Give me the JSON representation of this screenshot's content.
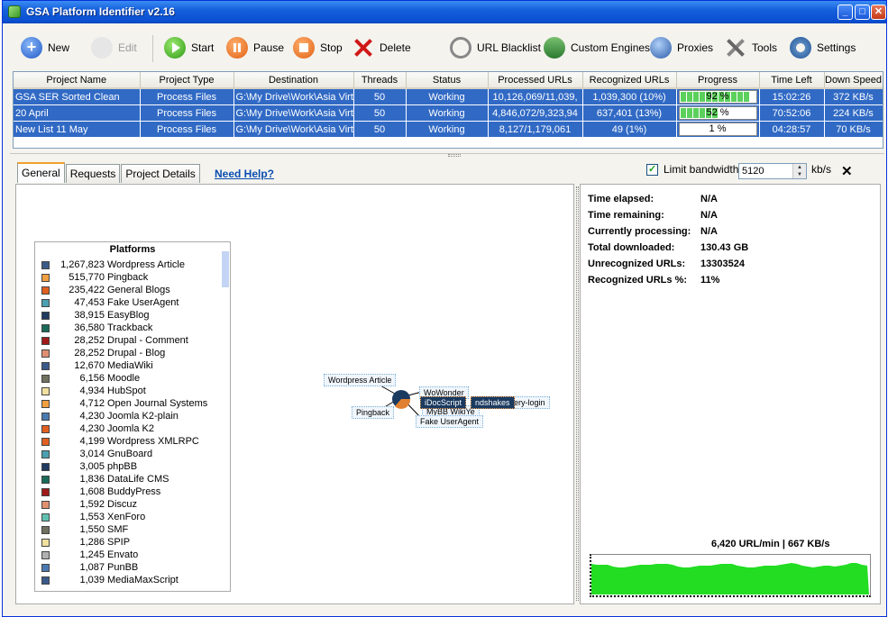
{
  "window": {
    "title": "GSA Platform Identifier v2.16",
    "controls": [
      "_",
      "□",
      "✕"
    ]
  },
  "toolbar": {
    "new": "New",
    "edit": "Edit",
    "start": "Start",
    "pause": "Pause",
    "stop": "Stop",
    "delete": "Delete",
    "url_blacklist": "URL Blacklist",
    "custom_engines": "Custom Engines",
    "proxies": "Proxies",
    "tools": "Tools",
    "settings": "Settings"
  },
  "projects": {
    "columns": [
      "Project Name",
      "Project Type",
      "Destination",
      "Threads",
      "Status",
      "Processed URLs",
      "Recognized URLs",
      "Progress",
      "Time Left",
      "Down Speed"
    ],
    "rows": [
      {
        "name": "GSA SER Sorted Clean",
        "type": "Process Files",
        "destination": "G:\\My Drive\\Work\\Asia Virt",
        "threads": "50",
        "status": "Working",
        "processed": "10,126,069/11,039,",
        "recognized": "1,039,300 (10%)",
        "progress_label": "92 %",
        "progress": 0.92,
        "time_left": "15:02:26",
        "speed": "372 KB/s"
      },
      {
        "name": "20 April",
        "type": "Process Files",
        "destination": "G:\\My Drive\\Work\\Asia Virt",
        "threads": "50",
        "status": "Working",
        "processed": "4,846,072/9,323,94",
        "recognized": "637,401 (13%)",
        "progress_label": "52 %",
        "progress": 0.52,
        "time_left": "70:52:06",
        "speed": "224 KB/s"
      },
      {
        "name": "New List 11 May",
        "type": "Process Files",
        "destination": "G:\\My Drive\\Work\\Asia Virt",
        "threads": "50",
        "status": "Working",
        "processed": "8,127/1,179,061",
        "recognized": "49 (1%)",
        "progress_label": "1 %",
        "progress": 0.01,
        "time_left": "04:28:57",
        "speed": "70 KB/s"
      }
    ]
  },
  "tabs": [
    "General",
    "Requests",
    "Project Details"
  ],
  "help_link": "Need Help?",
  "bandwidth": {
    "label": "Limit bandwidth:",
    "value": "5120",
    "unit": "kb/s",
    "checked": true
  },
  "platforms": {
    "title": "Platforms",
    "items": [
      {
        "count": "1,267,823",
        "name": "Wordpress Article",
        "color": "#3a5a8a"
      },
      {
        "count": "515,770",
        "name": "Pingback",
        "color": "#f0a040"
      },
      {
        "count": "235,422",
        "name": "General Blogs",
        "color": "#e06020"
      },
      {
        "count": "47,453",
        "name": "Fake UserAgent",
        "color": "#4aa0b0"
      },
      {
        "count": "38,915",
        "name": "EasyBlog",
        "color": "#203a60"
      },
      {
        "count": "36,580",
        "name": "Trackback",
        "color": "#1a6a5a"
      },
      {
        "count": "28,252",
        "name": "Drupal - Comment",
        "color": "#a01a1a"
      },
      {
        "count": "28,252",
        "name": "Drupal - Blog",
        "color": "#e09070"
      },
      {
        "count": "12,670",
        "name": "MediaWiki",
        "color": "#3a5a8a"
      },
      {
        "count": "6,156",
        "name": "Moodle",
        "color": "#707060"
      },
      {
        "count": "4,934",
        "name": "HubSpot",
        "color": "#f0e0a0"
      },
      {
        "count": "4,712",
        "name": "Open Journal Systems",
        "color": "#f0a040"
      },
      {
        "count": "4,230",
        "name": "Joomla K2-plain",
        "color": "#4a7ab0"
      },
      {
        "count": "4,230",
        "name": "Joomla K2",
        "color": "#e06020"
      },
      {
        "count": "4,199",
        "name": "Wordpress XMLRPC",
        "color": "#e06020"
      },
      {
        "count": "3,014",
        "name": "GnuBoard",
        "color": "#4aa0b0"
      },
      {
        "count": "3,005",
        "name": "phpBB",
        "color": "#203a60"
      },
      {
        "count": "1,836",
        "name": "DataLife CMS",
        "color": "#1a6a5a"
      },
      {
        "count": "1,608",
        "name": "BuddyPress",
        "color": "#a01a1a"
      },
      {
        "count": "1,592",
        "name": "Discuz",
        "color": "#e09070"
      },
      {
        "count": "1,553",
        "name": "XenForo",
        "color": "#60c0b0"
      },
      {
        "count": "1,550",
        "name": "SMF",
        "color": "#707060"
      },
      {
        "count": "1,286",
        "name": "SPIP",
        "color": "#f0e0a0"
      },
      {
        "count": "1,245",
        "name": "Envato",
        "color": "#b0b0b0"
      },
      {
        "count": "1,087",
        "name": "PunBB",
        "color": "#4a7ab0"
      },
      {
        "count": "1,039",
        "name": "MediaMaxScript",
        "color": "#3a5a8a"
      }
    ]
  },
  "mindmap": {
    "nodes": [
      "Wordpress Article",
      "Pingback",
      "WoWonder",
      "iDocScript",
      "ndshakes",
      "Gallery-login",
      "MyBB WikiYe",
      "Fake UserAgent"
    ]
  },
  "stats": [
    {
      "label": "Time elapsed:",
      "value": "N/A"
    },
    {
      "label": "Time remaining:",
      "value": "N/A"
    },
    {
      "label": "Currently processing:",
      "value": "N/A"
    },
    {
      "label": "Total downloaded:",
      "value": "130.43 GB"
    },
    {
      "label": "Unrecognized URLs:",
      "value": "13303524"
    },
    {
      "label": "Recognized URLs %:",
      "value": "11%"
    }
  ],
  "throughput": "6,420 URL/min | 667 KB/s",
  "colors": {
    "accent": "#316ac5",
    "graph_fill": "#22dd22"
  }
}
